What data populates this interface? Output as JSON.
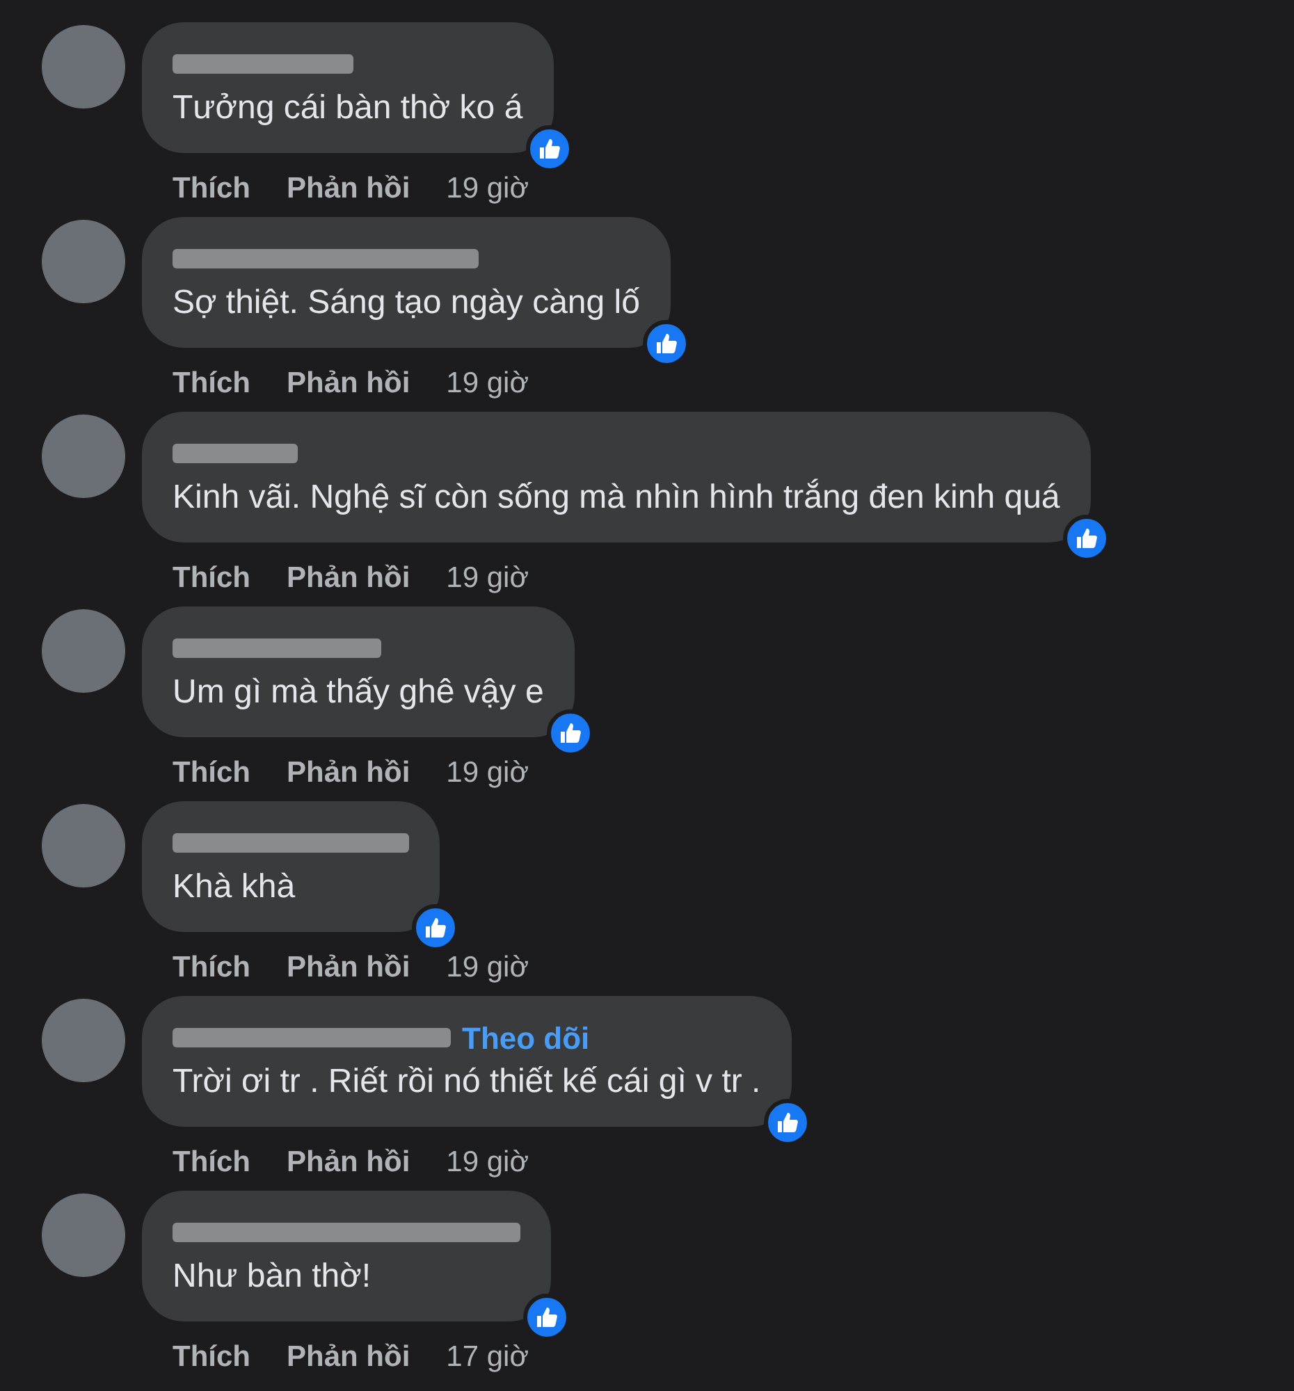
{
  "comments": [
    {
      "text": "Tưởng cái bàn thờ ko á",
      "liked": true,
      "actions": [
        "Thích",
        "Phản hồi"
      ],
      "time": "19 giờ"
    },
    {
      "text": "Sợ thiệt. Sáng tạo ngày càng lố",
      "liked": true,
      "actions": [
        "Thích",
        "Phản hồi"
      ],
      "time": "19 giờ"
    },
    {
      "text": "Kinh vãi. Nghệ sĩ còn sống mà nhìn hình trắng đen kinh quá",
      "liked": true,
      "actions": [
        "Thích",
        "Phản hồi"
      ],
      "time": "19 giờ"
    },
    {
      "text": "Um gì mà thấy ghê vậy e",
      "liked": true,
      "actions": [
        "Thích",
        "Phản hồi"
      ],
      "time": "19 giờ"
    },
    {
      "text": "Khà khà",
      "liked": true,
      "actions": [
        "Thích",
        "Phản hồi"
      ],
      "time": "19 giờ"
    },
    {
      "follow": "Theo dõi",
      "text": "Trời ơi tr . Riết rồi nó thiết kế cái gì v tr .",
      "liked": true,
      "actions": [
        "Thích",
        "Phản hồi"
      ],
      "time": "19 giờ"
    },
    {
      "text": "Như bàn thờ!",
      "liked": true,
      "actions": [
        "Thích",
        "Phản hồi"
      ],
      "time": "17 giờ"
    }
  ]
}
